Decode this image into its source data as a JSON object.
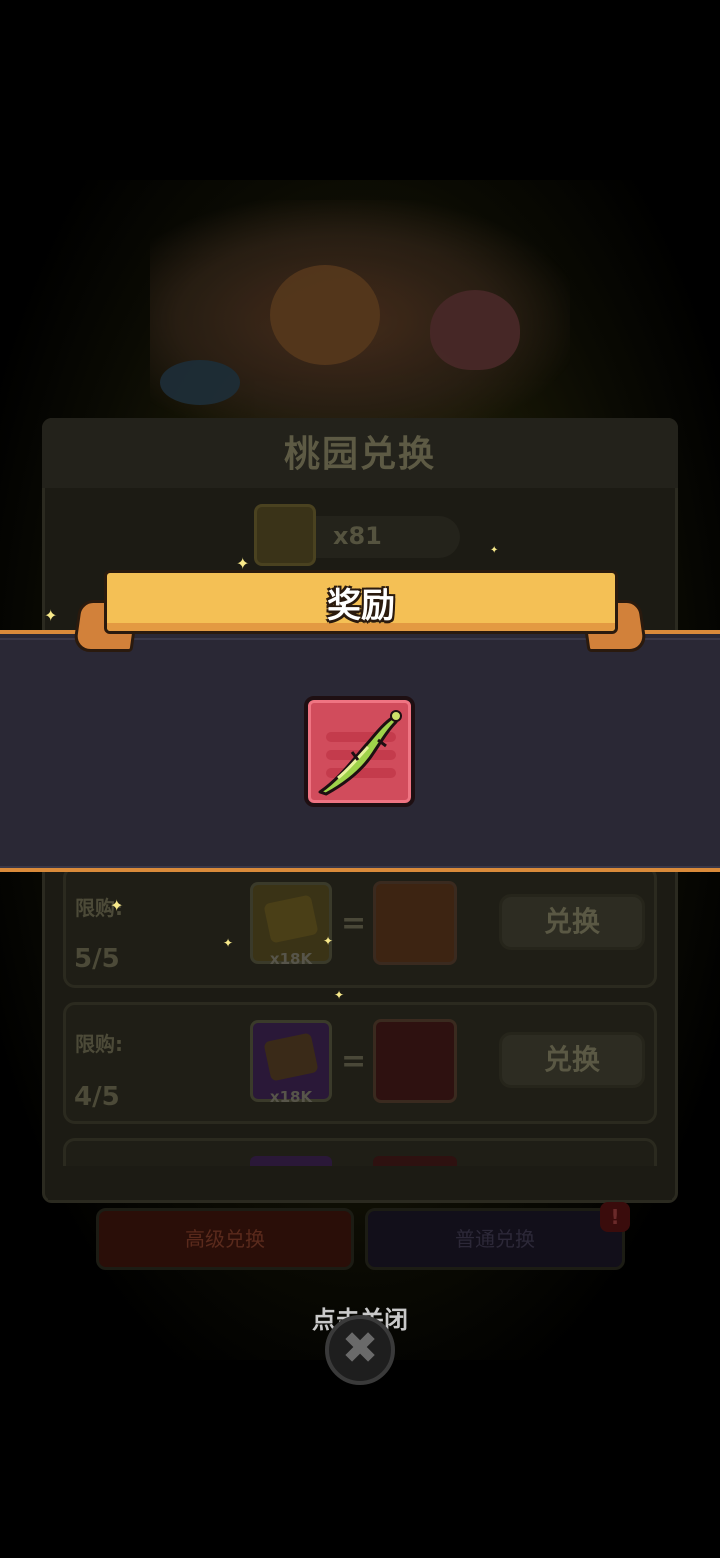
{
  "background_panel": {
    "title": "桃园兑换",
    "currency_count": "x81",
    "rows": [
      {
        "limit_label": "限购:",
        "limit_count": "5/5",
        "cost_label": "x18K",
        "button_label": "兑换"
      },
      {
        "limit_label": "限购:",
        "limit_count": "4/5",
        "cost_label": "x18K",
        "button_label": "兑换"
      }
    ],
    "tabs": {
      "senior": "高级兑换",
      "normal": "普通兑换",
      "badge": "!"
    }
  },
  "reward_popup": {
    "title": "奖励",
    "item_icon": "green-curved-blade-icon",
    "colors": {
      "ribbon": "#f4c055",
      "band": "#2a2835",
      "item_bg": "#d14c5c"
    }
  },
  "close": {
    "hint": "点击关闭",
    "icon": "close-icon",
    "glyph": "✖"
  }
}
